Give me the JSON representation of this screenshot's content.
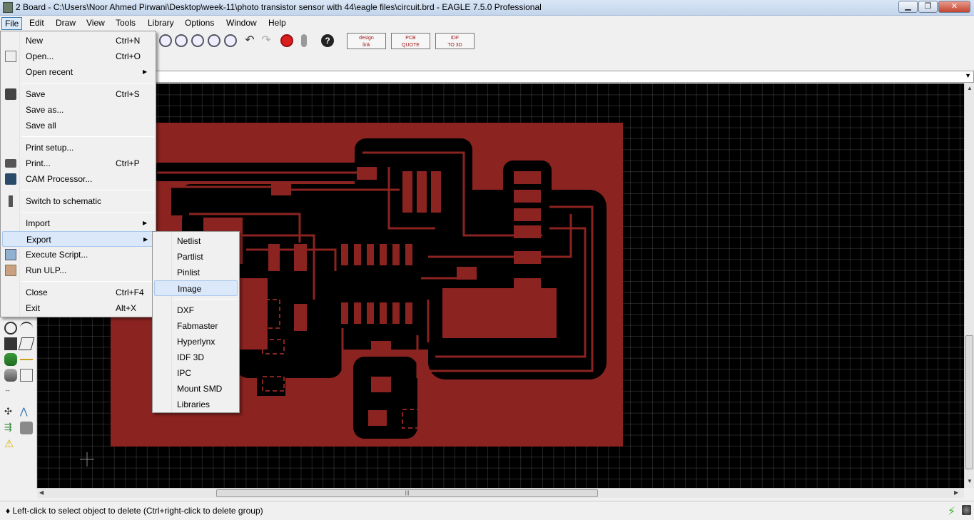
{
  "window": {
    "title": "2 Board - C:\\Users\\Noor Ahmed Pirwani\\Desktop\\week-11\\photo transistor sensor with 44\\eagle files\\circuit.brd - EAGLE 7.5.0 Professional",
    "min_glyph": "▁",
    "max_glyph": "❐",
    "close_glyph": "✕"
  },
  "menubar": [
    "File",
    "Edit",
    "Draw",
    "View",
    "Tools",
    "Library",
    "Options",
    "Window",
    "Help"
  ],
  "toolbar": {
    "badges": [
      {
        "line1": "design",
        "line2": "link"
      },
      {
        "line1": "PCB",
        "line2": "QUOTE"
      },
      {
        "line1": "IDF",
        "line2": "TO 3D"
      }
    ],
    "help_glyph": "?"
  },
  "file_menu": {
    "items": [
      {
        "label": "New",
        "shortcut": "Ctrl+N"
      },
      {
        "label": "Open...",
        "shortcut": "Ctrl+O"
      },
      {
        "label": "Open recent",
        "shortcut": "",
        "submenu": "▶"
      },
      {
        "label": "Save",
        "shortcut": "Ctrl+S"
      },
      {
        "label": "Save as...",
        "shortcut": ""
      },
      {
        "label": "Save all",
        "shortcut": ""
      },
      {
        "label": "Print setup...",
        "shortcut": ""
      },
      {
        "label": "Print...",
        "shortcut": "Ctrl+P"
      },
      {
        "label": "CAM Processor...",
        "shortcut": ""
      },
      {
        "label": "Switch to schematic",
        "shortcut": ""
      },
      {
        "label": "Import",
        "shortcut": "",
        "submenu": "▶"
      },
      {
        "label": "Export",
        "shortcut": "",
        "submenu": "▶"
      },
      {
        "label": "Execute Script...",
        "shortcut": ""
      },
      {
        "label": "Run ULP...",
        "shortcut": ""
      },
      {
        "label": "Close",
        "shortcut": "Ctrl+F4"
      },
      {
        "label": "Exit",
        "shortcut": "Alt+X"
      }
    ]
  },
  "export_menu": {
    "items": [
      "Netlist",
      "Partlist",
      "Pinlist",
      "Image",
      "DXF",
      "Fabmaster",
      "Hyperlynx",
      "IDF 3D",
      "IPC",
      "Mount SMD",
      "Libraries"
    ]
  },
  "statusbar": {
    "message": "♦ Left-click to select object to delete (Ctrl+right-click to delete group)",
    "go_glyph": "⚡"
  },
  "colors": {
    "board": "#8b2320",
    "canvas": "#000000",
    "menu_highlight": "#dbe8f9"
  }
}
